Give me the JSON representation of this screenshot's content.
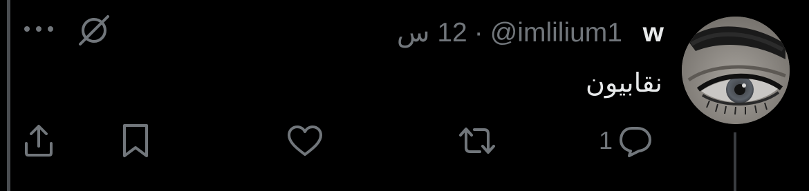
{
  "tweet": {
    "display_name": "w",
    "handle": "@imlilium1",
    "separator": "·",
    "timestamp": "12 س",
    "text": "نقابيون"
  },
  "actions": {
    "reply_count": "1",
    "reply_icon": "speech-bubble-icon",
    "retweet_icon": "retweet-arrows-icon",
    "like_icon": "heart-icon",
    "bookmark_icon": "bookmark-icon",
    "share_icon": "share-upload-icon"
  },
  "header_icons": {
    "more": "more-dots-icon",
    "hidden": "hidden-slash-icon"
  },
  "colors": {
    "background": "#000000",
    "text_primary": "#e7e9ea",
    "text_secondary": "#71767b",
    "rail": "#4a4d51"
  }
}
